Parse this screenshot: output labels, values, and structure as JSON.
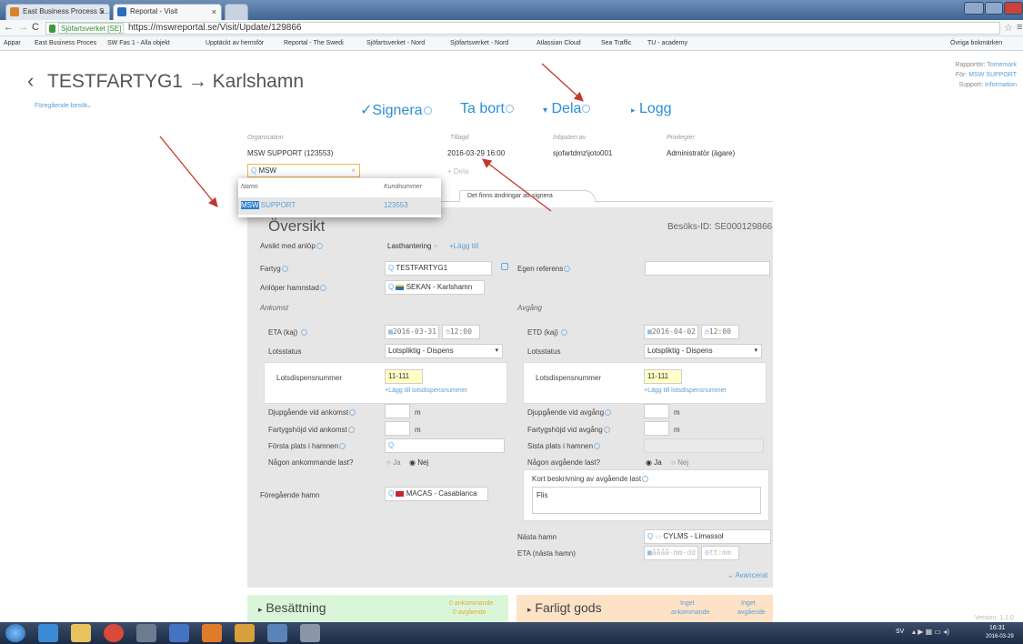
{
  "browser": {
    "tabs": [
      {
        "title": "East Business Process S..."
      },
      {
        "title": "Reportal - Visit"
      }
    ],
    "address": {
      "secure_label": "Sjöfartsverket [SE]",
      "url": "https://mswreportal.se/Visit/Update/129866"
    },
    "bookmarks": [
      "Appar",
      "East Business Proces",
      "SW Fas 1 - Alla objekt",
      "Upptäckt av hemsför",
      "Reportal - The Swedi",
      "Sjöfartsverket - Nord",
      "Sjöfartsverket - Nord",
      "Atlassian Cloud",
      "Sea Traffic",
      "TU - academy"
    ],
    "other_bookmarks": "Övriga bokmärken"
  },
  "header": {
    "title": "TESTFARTYG1 → Karlshamn",
    "prev_visit": "Föregående besök",
    "reporter_label": "Rapportör:",
    "reporter": "Tomemark",
    "for_label": "För:",
    "for_value": "MSW SUPPORT",
    "support_label": "Support:",
    "support_value": "Information"
  },
  "actions": {
    "sign": "Signera",
    "delete": "Ta bort",
    "share": "Dela",
    "log": "Logg"
  },
  "share_panel": {
    "headers": {
      "org": "Organisation",
      "added": "Tillagd",
      "invited_by": "Inbjuden av",
      "privileges": "Privilegier"
    },
    "row": {
      "org": "MSW SUPPORT (123553)",
      "added": "2016-03-29 16:00",
      "invited_by": "sjofartdmz\\joto001",
      "privileges": "Administratör (ägare)"
    },
    "search_value": "MSW",
    "share_button": "Dela",
    "dropdown": {
      "col_name": "Namn",
      "col_number": "Kundnummer",
      "result_match": "MSW",
      "result_rest": " SUPPORT",
      "result_number": "123553"
    }
  },
  "tabs_row": {
    "changes_notice": "Det finns ändringar att signera"
  },
  "overview": {
    "visit_id": "Besöks-ID: SE000129866",
    "purpose_label": "Avsikt med anlöp",
    "purpose_value": "Lasthantering",
    "add_link": "+Lägg till",
    "ship_label": "Fartyg",
    "ship_value": "TESTFARTYG1",
    "own_ref_label": "Egen referens",
    "port_label": "Anlöper hamnstad",
    "port_value": "SEKAN - Karlshamn"
  },
  "arrival": {
    "heading": "Ankomst",
    "eta_label": "ETA (kaj)",
    "eta_date": "2016-03-31",
    "eta_time": "12:00",
    "pilot_label": "Lotsstatus",
    "pilot_value": "Lotspliktig - Dispens",
    "disp_label": "Lotsdispensnummer",
    "disp_value": "11-111",
    "add_disp": "+Lägg till lotsdispensnummer",
    "draft_label": "Djupgående vid ankomst",
    "height_label": "Fartygshöjd vid ankomst",
    "unit": "m",
    "first_place_label": "Första plats i hamnen",
    "cargo_label": "Någon ankommande last?",
    "yes": "Ja",
    "no": "Nej",
    "prev_port_label": "Föregående hamn",
    "prev_port_value": "MACAS - Casablanca"
  },
  "departure": {
    "heading": "Avgång",
    "etd_label": "ETD (kaj)",
    "etd_date": "2016-04-02",
    "etd_time": "12:00",
    "pilot_label": "Lotsstatus",
    "pilot_value": "Lotspliktig - Dispens",
    "disp_label": "Lotsdispensnummer",
    "disp_value": "11-111",
    "add_disp": "+Lägg till lotsdispensnummer",
    "draft_label": "Djupgående vid avgång",
    "height_label": "Fartygshöjd vid avgång",
    "unit": "m",
    "last_place_label": "Sista plats i hamnen",
    "cargo_label": "Någon avgående last?",
    "yes": "Ja",
    "no": "Nej",
    "cargo_desc_label": "Kort beskrivning av avgående last",
    "cargo_desc_value": "Flis",
    "next_port_label": "Nästa hamn",
    "next_port_value": "CYLMS - Limassol",
    "eta_next_label": "ETA (nästa hamn)",
    "date_placeholder": "åååå-mm-dd",
    "time_placeholder": "tt:mm",
    "advanced": "Avancerat"
  },
  "cards": {
    "crew": {
      "title": "Besättning",
      "arr": "0 ankommande",
      "dep": "0 avgående"
    },
    "dangerous": {
      "title": "Farligt gods",
      "arr1": "Inget",
      "arr2": "ankommande",
      "dep1": "Inget",
      "dep2": "avgående"
    }
  },
  "version": "Version: 1.1.0",
  "tray": {
    "lang": "SV",
    "time": "16:31",
    "date": "2016-03-29"
  },
  "colors": {
    "accent": "#2a8fd6",
    "arrow": "#c0392b",
    "panel": "#e6e6e6",
    "crew_card": "#d9f6d9",
    "dangerous_card": "#fde2c6"
  }
}
